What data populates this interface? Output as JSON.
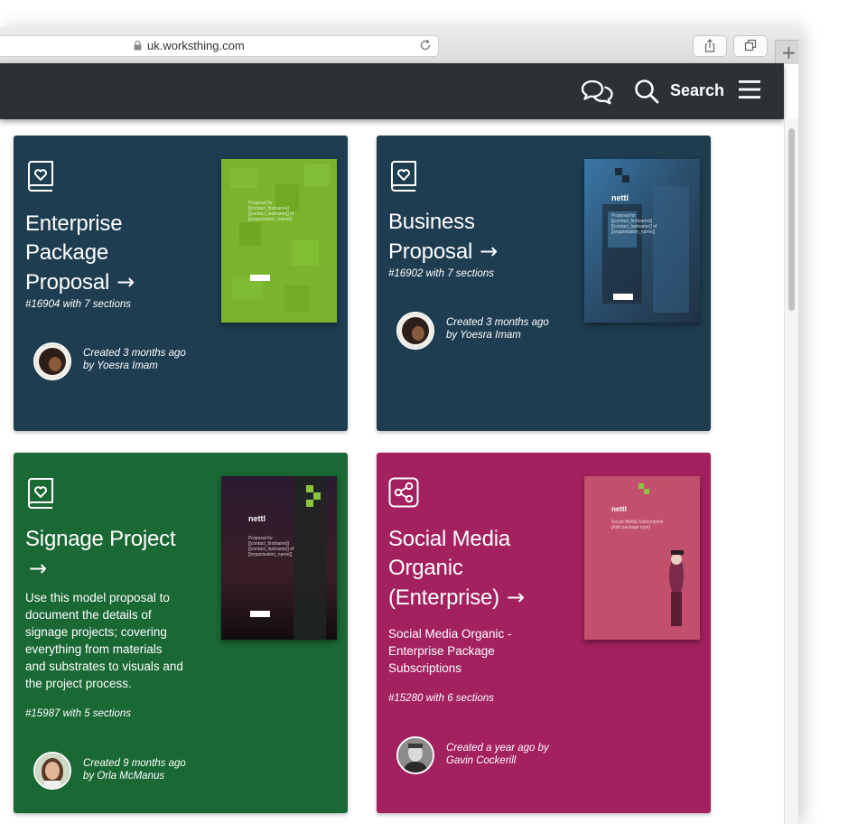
{
  "browser": {
    "url": "uk.worksthing.com",
    "new_tab": "+"
  },
  "header": {
    "search_label": "Search"
  },
  "cards": [
    {
      "title_lines": [
        "Enterprise",
        "Package",
        "Proposal"
      ],
      "arrow": "→",
      "ref": "#16904 with 7 sections",
      "created_line1": "Created 3 months ago",
      "created_line2": "by Yoesra Imam",
      "bg": "#1e3d51",
      "icon": "book-heart-icon",
      "thumb_bg": "#7ab52c",
      "thumb_text": "Proposal for [[contact_firstname]] [[contact_lastname]] of [[organisation_name]]",
      "thumb_logo": ""
    },
    {
      "title_lines": [
        "Business",
        "Proposal"
      ],
      "arrow": "→",
      "ref": "#16902 with 7 sections",
      "created_line1": "Created 3 months ago",
      "created_line2": "by Yoesra Imam",
      "bg": "#1e3d51",
      "icon": "book-heart-icon",
      "thumb_bg": "#2d5a7a",
      "thumb_text": "Proposal for [[contact_firstname]] [[contact_lastname]] of [[organisation_name]]",
      "thumb_logo": "nettl"
    },
    {
      "title_lines": [
        "Signage Project"
      ],
      "arrow": "→",
      "description": [
        "Use this model proposal to",
        "document the details of",
        "signage projects; covering",
        "everything from materials",
        "and substrates to visuals and",
        "the project process."
      ],
      "ref": "#15987 with 5 sections",
      "created_line1": "Created 9 months ago",
      "created_line2": "by Orla McManus",
      "bg": "#1a6834",
      "icon": "book-heart-icon",
      "thumb_bg": "#1c1420",
      "thumb_text": "Proposal for [[contact_firstname]] [[contact_lastname]] of [[organisation_name]]",
      "thumb_logo": "nettl"
    },
    {
      "title_lines": [
        "Social Media",
        "Organic",
        "(Enterprise)"
      ],
      "arrow": "→",
      "description": [
        "Social Media Organic -",
        "Enterprise Package",
        "Subscriptions"
      ],
      "ref": "#15280 with 6 sections",
      "created_line1": "Created a year ago by",
      "created_line2": "Gavin Cockerill",
      "bg": "#a3215f",
      "icon": "share-icon",
      "thumb_bg": "#c4506e",
      "thumb_text": "Social Media Subscription [Add package type]",
      "thumb_logo": "nettl"
    }
  ]
}
